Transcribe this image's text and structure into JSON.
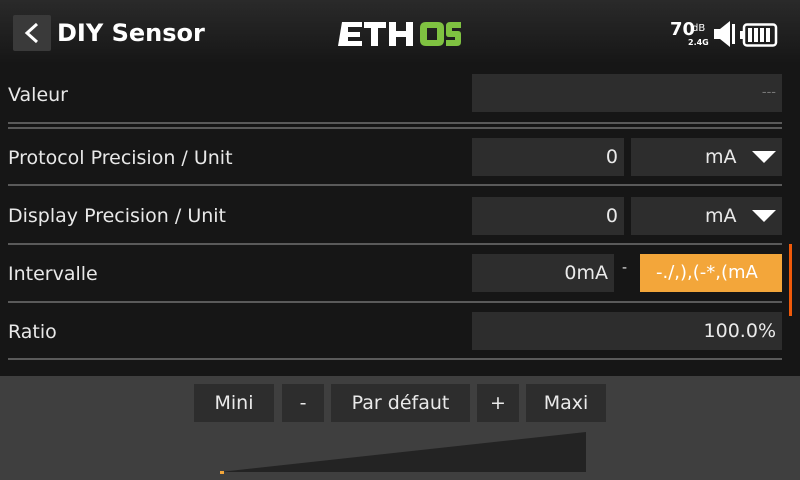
{
  "header": {
    "title": "DIY Sensor",
    "logo": "ETHOS",
    "logo_colors": {
      "eth": "#ffffff",
      "os": "#7fc241"
    },
    "rssi_value": "70",
    "rssi_unit": "dB",
    "rssi_band": "2.4G",
    "icons": [
      "back-chevron-icon",
      "volume-icon",
      "battery-icon"
    ]
  },
  "rows": {
    "valeur": {
      "label": "Valeur",
      "value": "---"
    },
    "protocol": {
      "label": "Protocol Precision / Unit",
      "precision": "0",
      "unit": "mA"
    },
    "display": {
      "label": "Display Precision / Unit",
      "precision": "0",
      "unit": "mA"
    },
    "intervalle": {
      "label": "Intervalle",
      "min": "0mA",
      "separator": "-",
      "max": "-./,),(-*,(mA"
    },
    "ratio": {
      "label": "Ratio",
      "value": "100.0%"
    }
  },
  "bottom_buttons": {
    "mini": "Mini",
    "minus": "-",
    "default": "Par défaut",
    "plus": "+",
    "maxi": "Maxi"
  },
  "colors": {
    "accent_orange": "#f3a63a",
    "scroll_indicator": "#f05a0a"
  }
}
